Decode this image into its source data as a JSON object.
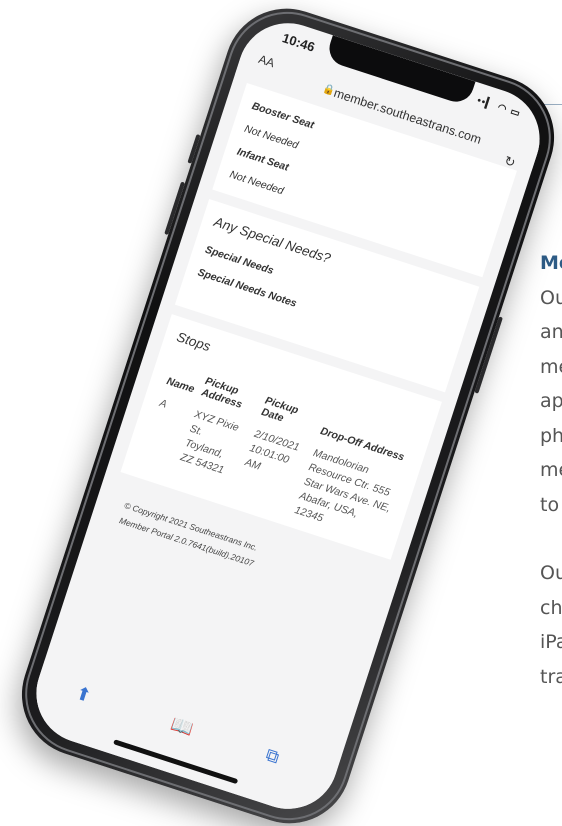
{
  "page": {
    "side_heading": "Mo",
    "side_lines_1": [
      "Ou",
      "an",
      "me",
      "ap",
      "ph",
      "me",
      "to"
    ],
    "side_lines_2": [
      "Ou",
      "ch",
      "iPa",
      "tra"
    ]
  },
  "phone": {
    "status": {
      "time": "10:46",
      "signal": "••▎ ◠ ▭"
    },
    "browser": {
      "text_size": "AA",
      "lock_icon": "🔒",
      "url": "member.southeastrans.com",
      "reload_icon": "↻"
    },
    "seats": [
      {
        "label": "Booster Seat",
        "value": "Not Needed"
      },
      {
        "label": "Infant Seat",
        "value": "Not Needed"
      }
    ],
    "special": {
      "title": "Any Special Needs?",
      "needs_label": "Special Needs",
      "notes_label": "Special Needs Notes"
    },
    "stops": {
      "title": "Stops",
      "columns": [
        "Name",
        "Pickup Address",
        "Pickup Date",
        "Drop-Off Address"
      ],
      "rows": [
        {
          "name": "A",
          "pickup_address": "XYZ Pixie St. Toyland, ZZ 54321",
          "pickup_date": "2/10/2021 10:01:00 AM",
          "dropoff_address": "Mandolorian Resource Ctr. 555 Star Wars Ave. NE, Abafar, USA, 12345"
        }
      ]
    },
    "footer": {
      "copyright": "© Copyright 2021 Southeastrans Inc.",
      "version": "Member Portal 2.0.7641(build).20107"
    },
    "toolbar": {
      "share_icon": "⬆",
      "bookmarks_icon": "📖",
      "tabs_icon": "⧉"
    }
  }
}
